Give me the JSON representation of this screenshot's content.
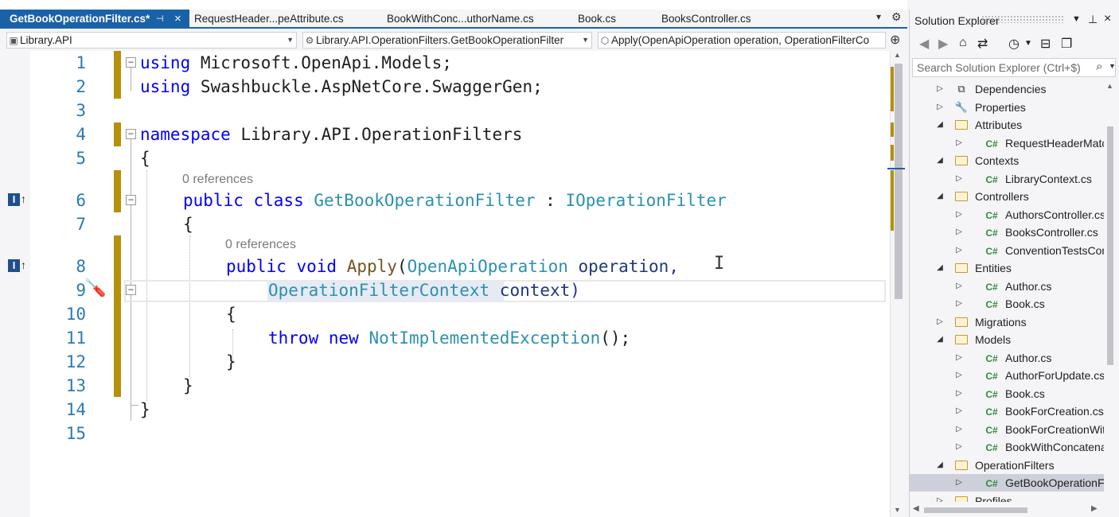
{
  "tabs": [
    {
      "label": "GetBookOperationFilter.cs*",
      "active": true
    },
    {
      "label": "RequestHeader...peAttribute.cs"
    },
    {
      "label": "BookWithConc...uthorName.cs"
    },
    {
      "label": "Book.cs"
    },
    {
      "label": "BooksController.cs"
    }
  ],
  "nav": {
    "project": "Library.API",
    "type": "Library.API.OperationFilters.GetBookOperationFilter",
    "member": "Apply(OpenApiOperation operation, OperationFilterCo"
  },
  "code": {
    "line_numbers": [
      "1",
      "2",
      "3",
      "4",
      "5",
      "6",
      "7",
      "8",
      "9",
      "10",
      "11",
      "12",
      "13",
      "14",
      "15"
    ],
    "lens_class": "0 references",
    "lens_method": "0 references",
    "l1": {
      "kw": "using",
      "rest": " Microsoft.OpenApi.Models;"
    },
    "l2": {
      "kw": "using",
      "rest": " Swashbuckle.AspNetCore.SwaggerGen;"
    },
    "l4": {
      "kw": "namespace",
      "rest": " Library.API.OperationFilters"
    },
    "l5": "{",
    "l6": {
      "kw1": "public",
      "kw2": " class ",
      "type": "GetBookOperationFilter",
      "sep": " : ",
      "iface": "IOperationFilter"
    },
    "l7": "{",
    "l8": {
      "kw1": "public",
      "kw2": " void ",
      "fn": "Apply",
      "open": "(",
      "ptype": "OpenApiOperation",
      "pname": " operation,"
    },
    "l9": {
      "ptype": "OperationFilterContext",
      "pname": " context)"
    },
    "l10": "{",
    "l11": {
      "kw1": "throw",
      "kw2": " new ",
      "type": "NotImplementedException",
      "rest": "();"
    },
    "l12": "}",
    "l13": "}",
    "l14": "}"
  },
  "solution_explorer": {
    "title": "Solution Explorer",
    "search_placeholder": "Search Solution Explorer (Ctrl+$)",
    "tree": [
      {
        "label": "Dependencies",
        "icon": "dependencies-icon",
        "expanded": false,
        "level": 0
      },
      {
        "label": "Properties",
        "icon": "properties-icon",
        "expanded": false,
        "level": 0
      },
      {
        "label": "Attributes",
        "icon": "folder-icon",
        "expanded": true,
        "level": 0
      },
      {
        "label": "RequestHeaderMatches",
        "icon": "csharp-file-icon",
        "expanded": false,
        "level": 1
      },
      {
        "label": "Contexts",
        "icon": "folder-icon",
        "expanded": true,
        "level": 0
      },
      {
        "label": "LibraryContext.cs",
        "icon": "csharp-file-icon",
        "expanded": false,
        "level": 1
      },
      {
        "label": "Controllers",
        "icon": "folder-icon",
        "expanded": true,
        "level": 0
      },
      {
        "label": "AuthorsController.cs",
        "icon": "csharp-file-icon",
        "expanded": false,
        "level": 1
      },
      {
        "label": "BooksController.cs",
        "icon": "csharp-file-icon",
        "expanded": false,
        "level": 1
      },
      {
        "label": "ConventionTestsContro",
        "icon": "csharp-file-icon",
        "expanded": false,
        "level": 1
      },
      {
        "label": "Entities",
        "icon": "folder-icon",
        "expanded": true,
        "level": 0
      },
      {
        "label": "Author.cs",
        "icon": "csharp-file-icon",
        "expanded": false,
        "level": 1
      },
      {
        "label": "Book.cs",
        "icon": "csharp-file-icon",
        "expanded": false,
        "level": 1
      },
      {
        "label": "Migrations",
        "icon": "folder-icon",
        "expanded": false,
        "level": 0
      },
      {
        "label": "Models",
        "icon": "folder-icon",
        "expanded": true,
        "level": 0
      },
      {
        "label": "Author.cs",
        "icon": "csharp-file-icon",
        "expanded": false,
        "level": 1
      },
      {
        "label": "AuthorForUpdate.cs",
        "icon": "csharp-file-icon",
        "expanded": false,
        "level": 1
      },
      {
        "label": "Book.cs",
        "icon": "csharp-file-icon",
        "expanded": false,
        "level": 1
      },
      {
        "label": "BookForCreation.cs",
        "icon": "csharp-file-icon",
        "expanded": false,
        "level": 1
      },
      {
        "label": "BookForCreationWithA",
        "icon": "csharp-file-icon",
        "expanded": false,
        "level": 1
      },
      {
        "label": "BookWithConcatenatec",
        "icon": "csharp-file-icon",
        "expanded": false,
        "level": 1
      },
      {
        "label": "OperationFilters",
        "icon": "folder-icon",
        "expanded": true,
        "level": 0
      },
      {
        "label": "GetBookOperationFilter",
        "icon": "csharp-file-icon",
        "expanded": false,
        "level": 1,
        "selected": true
      },
      {
        "label": "Profiles",
        "icon": "folder-icon",
        "expanded": false,
        "level": 0
      }
    ]
  },
  "icons": {
    "csharp": "C#",
    "tab_close": "×",
    "tab_pin": "⊣",
    "inherit_marker": "I"
  },
  "colors": {
    "accent": "#1a62a8",
    "changed_margin": "#b5900b",
    "keyword": "#0000ff",
    "type": "#2b91af",
    "line_number": "#2b7ab5"
  }
}
